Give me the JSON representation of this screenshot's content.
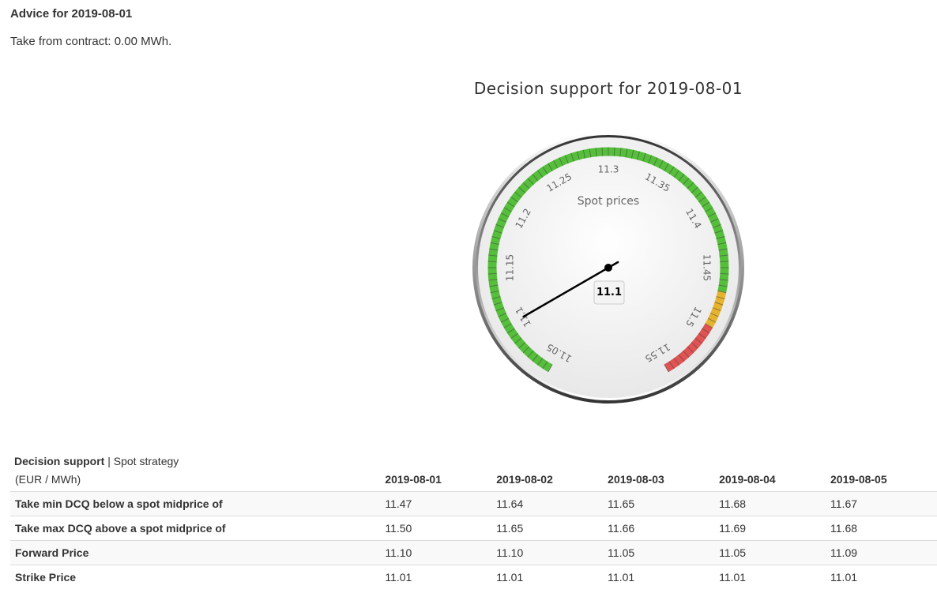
{
  "advice": {
    "title": "Advice for 2019-08-01",
    "text": "Take from contract: 0.00 MWh."
  },
  "gauge": {
    "title": "Decision support for 2019-08-01",
    "subtitle": "Spot prices",
    "min": 11.05,
    "max": 11.55,
    "value": 11.1,
    "value_label": "11.1",
    "tick_labels": [
      "11.05",
      "11.1",
      "11.15",
      "11.2",
      "11.25",
      "11.3",
      "11.35",
      "11.4",
      "11.45",
      "11.5",
      "11.55"
    ],
    "bands": [
      {
        "from": 11.05,
        "to": 11.47,
        "color": "#55bf3b"
      },
      {
        "from": 11.47,
        "to": 11.5,
        "color": "#dddf0d"
      },
      {
        "from": 11.5,
        "to": 11.55,
        "color": "#df5353"
      }
    ],
    "colors": {
      "green": "#55bf3b",
      "yellow": "#e6b32e",
      "red": "#df5353",
      "needle": "#000000"
    }
  },
  "table": {
    "caption_bold": "Decision support",
    "caption_rest": " | Spot strategy",
    "unit": "(EUR / MWh)",
    "columns": [
      "2019-08-01",
      "2019-08-02",
      "2019-08-03",
      "2019-08-04",
      "2019-08-05"
    ],
    "rows": [
      {
        "label": "Take min DCQ below a spot midprice of",
        "values": [
          "11.47",
          "11.64",
          "11.65",
          "11.68",
          "11.67"
        ]
      },
      {
        "label": "Take max DCQ above a spot midprice of",
        "values": [
          "11.50",
          "11.65",
          "11.66",
          "11.69",
          "11.68"
        ]
      },
      {
        "label": "Forward Price",
        "values": [
          "11.10",
          "11.10",
          "11.05",
          "11.05",
          "11.09"
        ]
      },
      {
        "label": "Strike Price",
        "values": [
          "11.01",
          "11.01",
          "11.01",
          "11.01",
          "11.01"
        ]
      }
    ]
  }
}
